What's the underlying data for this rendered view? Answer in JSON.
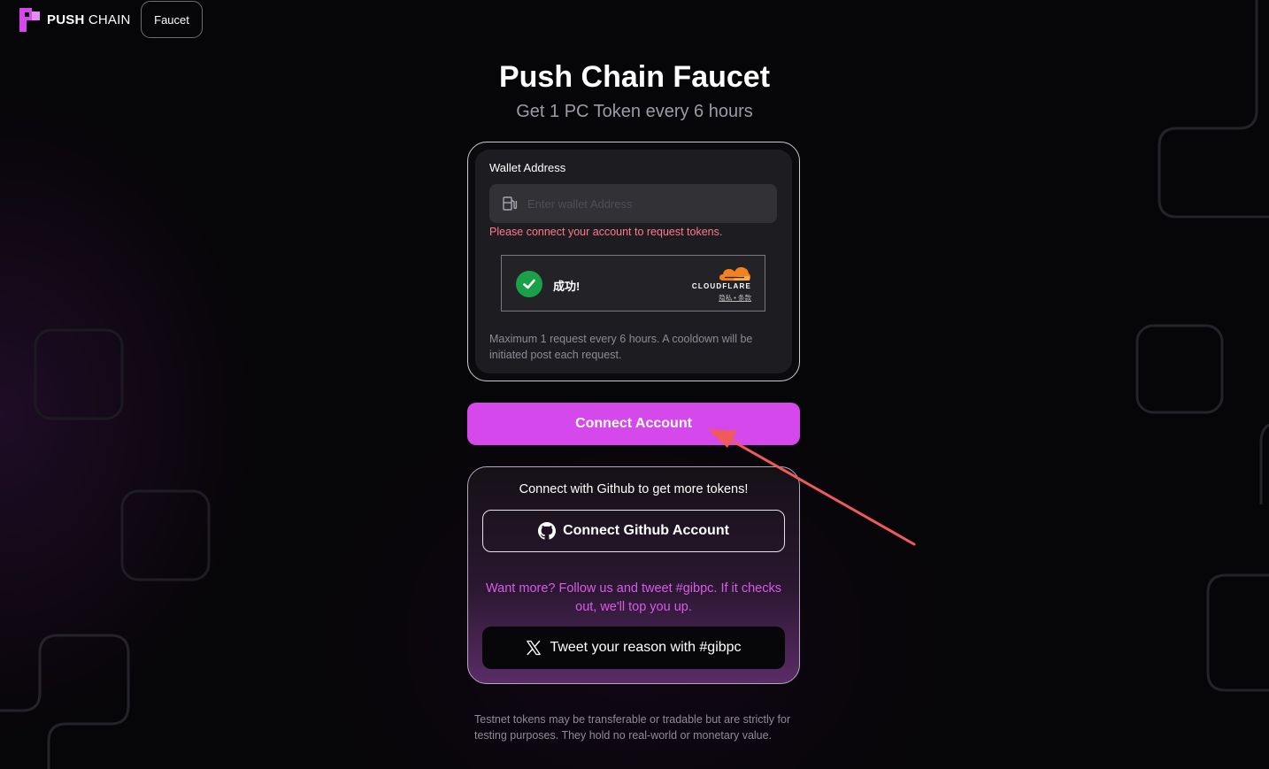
{
  "header": {
    "brand_bold": "PUSH",
    "brand_light": "CHAIN",
    "tab_label": "Faucet"
  },
  "hero": {
    "title": "Push Chain Faucet",
    "subtitle": "Get 1 PC Token every 6 hours"
  },
  "request_card": {
    "wallet_label": "Wallet Address",
    "wallet_placeholder": "Enter wallet Address",
    "wallet_value": "",
    "error_message": "Please connect your account to request tokens.",
    "captcha": {
      "status_text": "成功!",
      "brand": "CLOUDFLARE",
      "links": "隐私 • 条款",
      "status_color": "#1aa048"
    },
    "cooldown_note": "Maximum 1 request every 6 hours. A cooldown will be initiated post each request."
  },
  "connect_button_label": "Connect Account",
  "github_card": {
    "heading": "Connect with Github to get more tokens!",
    "github_button_label": "Connect Github Account",
    "promo_text": "Want more? Follow us and tweet #gibpc. If it checks out, we'll top you up.",
    "tweet_button_label": "Tweet your reason with #gibpc"
  },
  "disclaimer": "Testnet tokens may be transferable or tradable but are strictly for testing purposes. They hold no real-world or monetary value.",
  "colors": {
    "accent": "#d548ec",
    "error": "#ff7a8a",
    "promo": "#d95ae8",
    "annotation_arrow": "#ef5a5a"
  },
  "icons": {
    "logo": "push-chain-logo-icon",
    "wallet_field": "fuel-pump-icon",
    "captcha_check": "checkmark-icon",
    "github": "github-icon",
    "tweet": "x-logo-icon"
  }
}
